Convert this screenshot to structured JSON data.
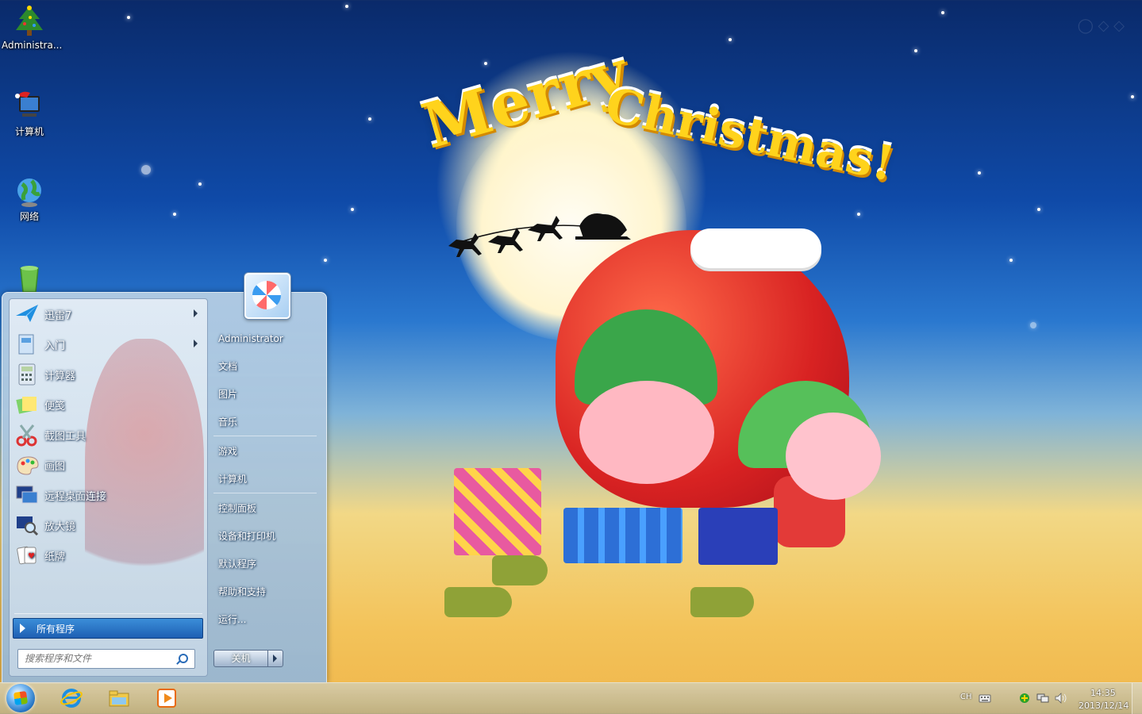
{
  "desktop": {
    "icons": [
      {
        "label": "Administra...",
        "icon": "christmas-tree-icon"
      },
      {
        "label": "计算机",
        "icon": "computer-icon"
      },
      {
        "label": "网络",
        "icon": "network-globe-icon"
      },
      {
        "label": "",
        "icon": "recycle-bin-icon"
      }
    ],
    "wallpaper_text": {
      "line1": "Merry",
      "line2": "Christmas!"
    }
  },
  "start_menu": {
    "programs": [
      {
        "label": "迅雷7",
        "icon": "xunlei-icon",
        "has_submenu": true
      },
      {
        "label": "入门",
        "icon": "getting-started-icon",
        "has_submenu": true
      },
      {
        "label": "计算器",
        "icon": "calculator-icon",
        "has_submenu": false
      },
      {
        "label": "便笺",
        "icon": "sticky-notes-icon",
        "has_submenu": false
      },
      {
        "label": "截图工具",
        "icon": "snipping-tool-icon",
        "has_submenu": false
      },
      {
        "label": "画图",
        "icon": "paint-icon",
        "has_submenu": false
      },
      {
        "label": "远程桌面连接",
        "icon": "remote-desktop-icon",
        "has_submenu": false
      },
      {
        "label": "放大镜",
        "icon": "magnifier-icon",
        "has_submenu": false
      },
      {
        "label": "纸牌",
        "icon": "solitaire-icon",
        "has_submenu": false
      }
    ],
    "all_programs": "所有程序",
    "search_placeholder": "搜索程序和文件",
    "right_items": [
      {
        "label": "Administrator"
      },
      {
        "label": "文档"
      },
      {
        "label": "图片"
      },
      {
        "label": "音乐"
      },
      {
        "label": "游戏"
      },
      {
        "label": "计算机"
      },
      {
        "label": "控制面板"
      },
      {
        "label": "设备和打印机"
      },
      {
        "label": "默认程序"
      },
      {
        "label": "帮助和支持"
      },
      {
        "label": "运行..."
      }
    ],
    "shutdown_label": "关机"
  },
  "taskbar": {
    "pinned": [
      {
        "icon": "internet-explorer-icon"
      },
      {
        "icon": "file-explorer-icon"
      },
      {
        "icon": "media-player-icon"
      }
    ],
    "tray": {
      "language": "CH",
      "time": "14:35",
      "date": "2013/12/14"
    }
  },
  "colors": {
    "accent": "#1e5fb3",
    "wallpaper_top": "#0a2a6a",
    "wallpaper_bottom": "#f0b64b"
  }
}
